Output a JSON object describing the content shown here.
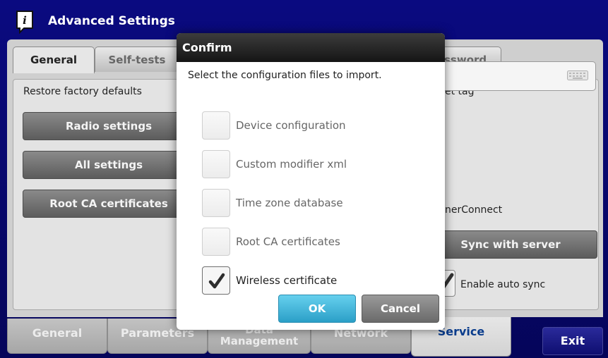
{
  "app": {
    "title": "Advanced Settings",
    "icon": "info-book-icon"
  },
  "tabs": [
    {
      "label": "General",
      "active": true
    },
    {
      "label": "Self-tests",
      "active": false
    },
    {
      "label": "ssword",
      "active": false
    }
  ],
  "left_panel": {
    "section_label": "Restore factory defaults",
    "buttons": [
      {
        "label": "Radio settings"
      },
      {
        "label": "All settings"
      },
      {
        "label": "Root CA certificates"
      }
    ]
  },
  "right_panel": {
    "asset_label": "et tag",
    "asset_value": "",
    "keyboard_icon": "keyboard-icon",
    "connect_label": "nerConnect",
    "sync_button": "Sync with server",
    "auto_sync_label": "Enable auto sync",
    "auto_sync_checked": true
  },
  "bottom_nav": {
    "items": [
      {
        "label": "General",
        "active": false
      },
      {
        "label": "Parameters",
        "active": false
      },
      {
        "label": "Data Management",
        "active": false
      },
      {
        "label": "Network",
        "active": false
      },
      {
        "label": "Service",
        "active": true
      }
    ],
    "exit_label": "Exit"
  },
  "dialog": {
    "title": "Confirm",
    "prompt": "Select the configuration files to import.",
    "options": [
      {
        "label": "Device configuration",
        "checked": false
      },
      {
        "label": "Custom modifier xml",
        "checked": false
      },
      {
        "label": "Time zone database",
        "checked": false
      },
      {
        "label": "Root CA certificates",
        "checked": false
      },
      {
        "label": "Wireless certificate",
        "checked": true
      }
    ],
    "ok_label": "OK",
    "cancel_label": "Cancel"
  },
  "colors": {
    "title_bar": "#0a0a80",
    "ok_button": "#3fb2d8",
    "active_nav_text": "#0a3c8c"
  }
}
